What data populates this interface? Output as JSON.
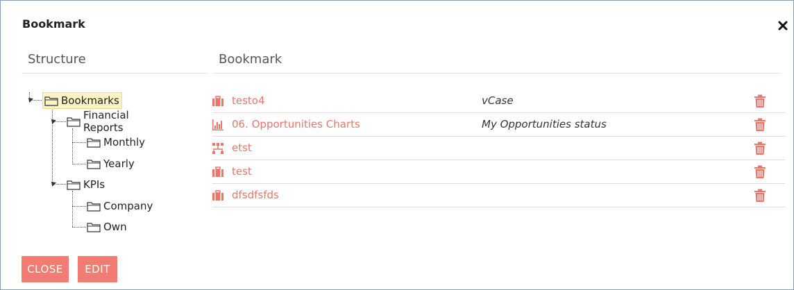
{
  "dialog": {
    "title": "Bookmark"
  },
  "structure": {
    "heading": "Structure",
    "tree": {
      "root": "Bookmarks",
      "financial": "Financial Reports",
      "monthly": "Monthly",
      "yearly": "Yearly",
      "kpis": "KPIs",
      "company": "Company",
      "own": "Own"
    }
  },
  "bookmarks": {
    "heading": "Bookmark",
    "accent_color": "#e8766b",
    "items": [
      {
        "name": "testo4",
        "description": "vCase",
        "icon": "briefcase-icon"
      },
      {
        "name": "06. Opportunities Charts",
        "description": "My Opportunities status",
        "icon": "bar-chart-icon"
      },
      {
        "name": "etst",
        "description": "",
        "icon": "network-icon"
      },
      {
        "name": "test",
        "description": "",
        "icon": "briefcase-icon"
      },
      {
        "name": "dfsdfsfds",
        "description": "",
        "icon": "briefcase-icon"
      }
    ]
  },
  "footer": {
    "close_label": "CLOSE",
    "edit_label": "EDIT"
  }
}
